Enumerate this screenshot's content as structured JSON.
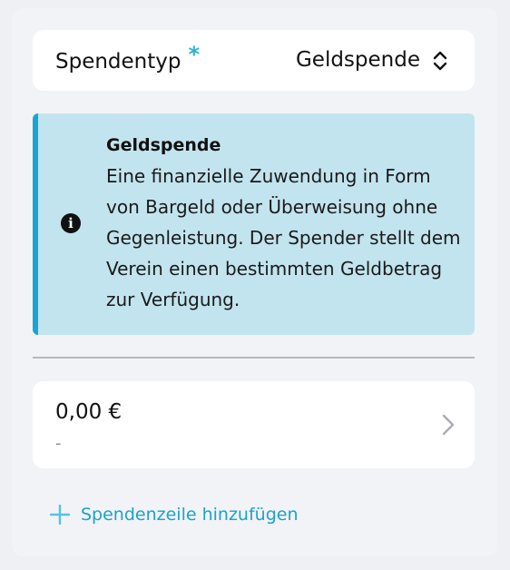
{
  "donation_type": {
    "label": "Spendentyp",
    "required_marker": "*",
    "value": "Geldspende",
    "icon": "chevron-up-down-icon"
  },
  "info": {
    "icon": "info-icon",
    "icon_glyph": "i",
    "title": "Geldspende",
    "text": "Eine finanzielle Zuwendung in Form von Bargeld oder Überweisung ohne Gegenleistung. Der Spender stellt dem Verein einen bestimmten Geldbetrag zur Verfügung."
  },
  "donation_line": {
    "amount": "0,00 €",
    "subtitle": "-",
    "icon": "chevron-right-icon"
  },
  "add_line": {
    "label": "Spendenzeile hinzufügen",
    "icon": "plus-icon"
  },
  "colors": {
    "accent": "#17a6d4",
    "info_background": "#c2e4ef",
    "page_background": "#eef0f4",
    "card_background": "#ffffff"
  }
}
